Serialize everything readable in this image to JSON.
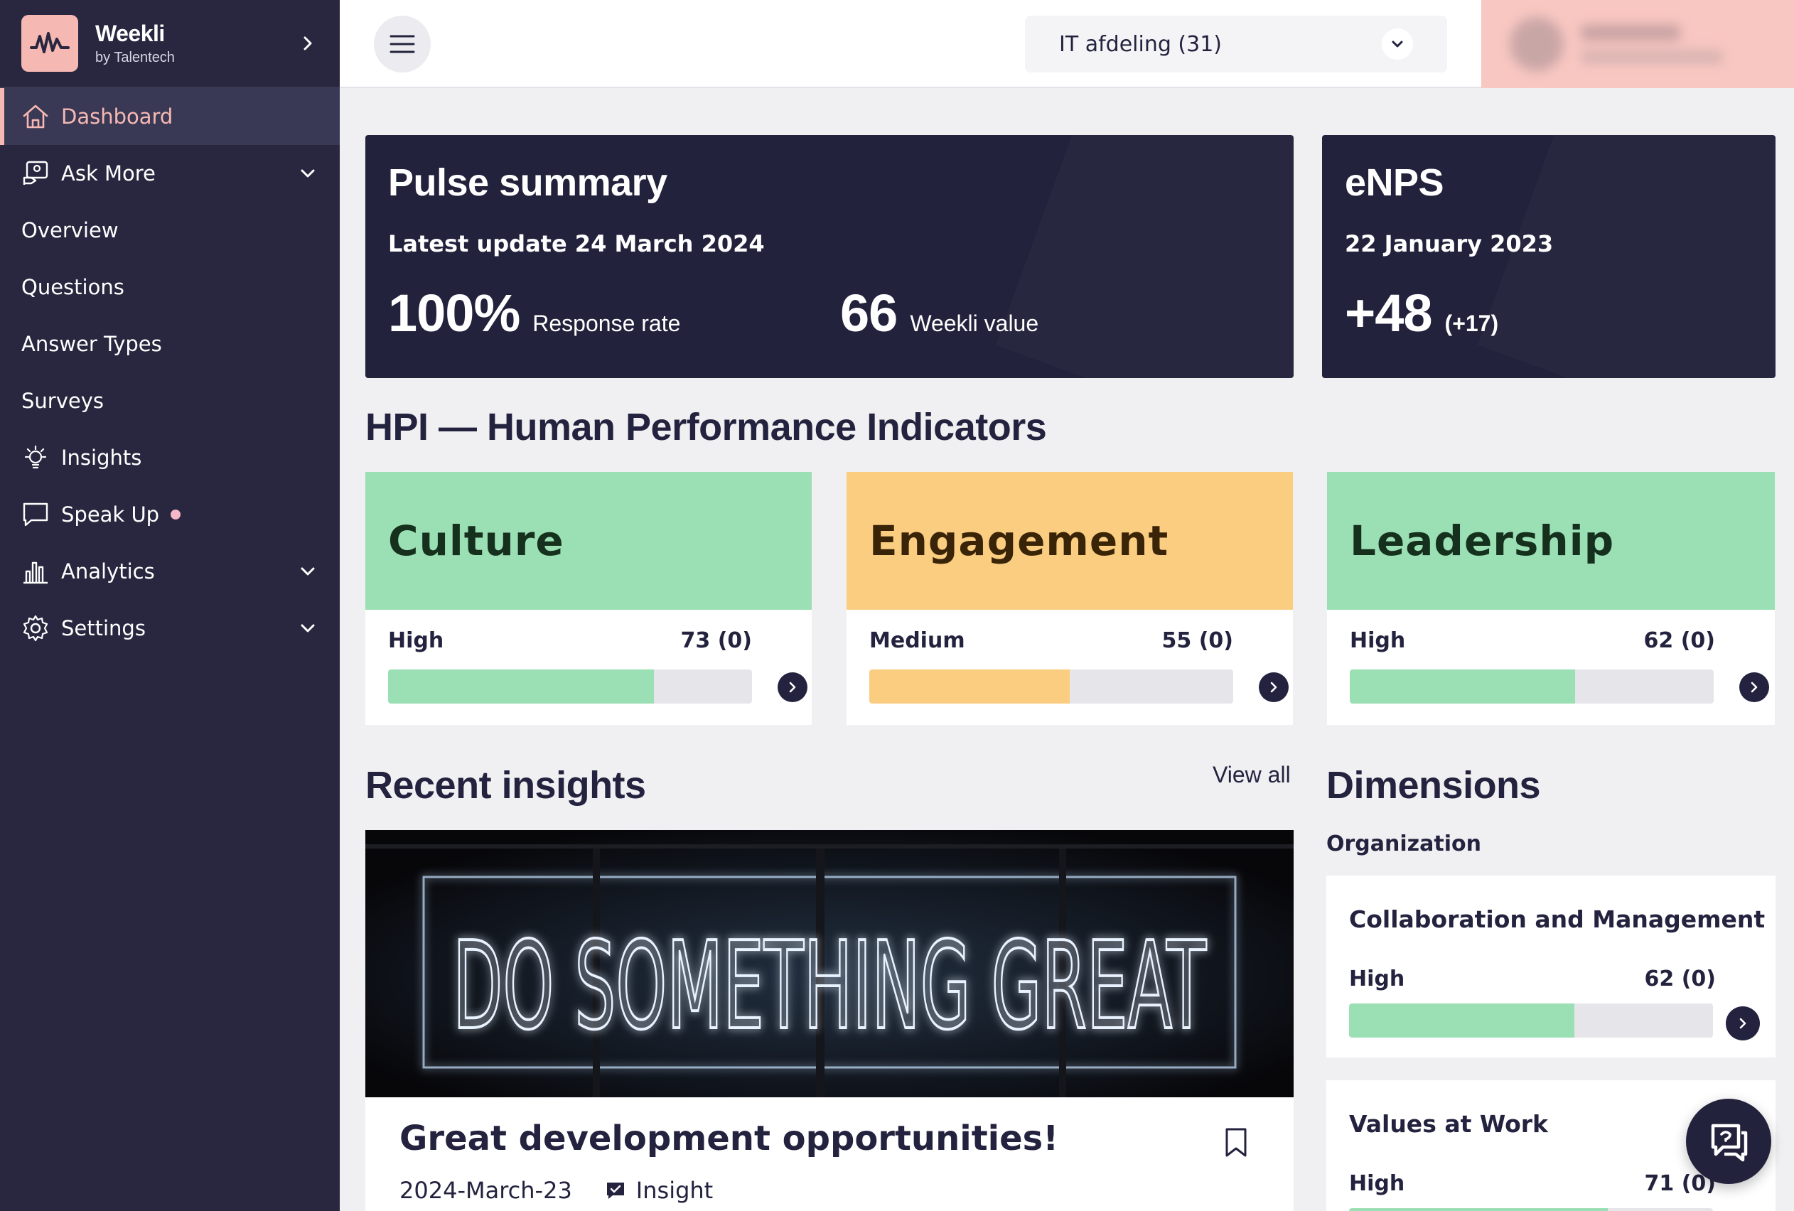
{
  "brand": {
    "name": "Weekli",
    "sub": "by Talentech"
  },
  "sidebar": {
    "items": [
      {
        "label": "Dashboard",
        "icon": "home-icon",
        "active": true
      },
      {
        "label": "Ask More",
        "icon": "ask-more-icon",
        "expandable": true
      },
      {
        "label": "Overview"
      },
      {
        "label": "Questions"
      },
      {
        "label": "Answer Types"
      },
      {
        "label": "Surveys"
      },
      {
        "label": "Insights",
        "icon": "lightbulb-icon"
      },
      {
        "label": "Speak Up",
        "icon": "speech-bubble-icon",
        "badge_dot": true
      },
      {
        "label": "Analytics",
        "icon": "bar-chart-icon",
        "expandable": true
      },
      {
        "label": "Settings",
        "icon": "gear-icon",
        "expandable": true
      }
    ]
  },
  "topbar": {
    "org_select": "IT afdeling (31)"
  },
  "pulse": {
    "title": "Pulse summary",
    "subtitle": "Latest update 24 March 2024",
    "response_value": "100%",
    "response_label": "Response rate",
    "weekli_value": "66",
    "weekli_label": "Weekli value"
  },
  "enps": {
    "title": "eNPS",
    "date": "22 January 2023",
    "value": "+48",
    "delta": "(+17)"
  },
  "hpi": {
    "heading": "HPI — Human Performance Indicators",
    "cards": [
      {
        "title": "Culture",
        "level": "High",
        "score": "73 (0)",
        "percent": 73,
        "head_color": "#9bdfb4",
        "bar_color": "#9bdfb4",
        "title_color": "#15301d"
      },
      {
        "title": "Engagement",
        "level": "Medium",
        "score": "55 (0)",
        "percent": 55,
        "head_color": "#fbcd80",
        "bar_color": "#fbcd80",
        "title_color": "#3a2408"
      },
      {
        "title": "Leadership",
        "level": "High",
        "score": "62 (0)",
        "percent": 62,
        "head_color": "#9bdfb4",
        "bar_color": "#9bdfb4",
        "title_color": "#15301d"
      }
    ]
  },
  "insights": {
    "heading": "Recent insights",
    "view_all": "View all",
    "image_text": "DO SOMETHING GREAT",
    "card": {
      "title": "Great development opportunities!",
      "date": "2024-March-23",
      "type": "Insight"
    }
  },
  "dimensions": {
    "heading": "Dimensions",
    "group": "Organization",
    "cards": [
      {
        "title": "Collaboration and Management",
        "level": "High",
        "score": "62 (0)",
        "percent": 62
      },
      {
        "title": "Values at Work",
        "level": "High",
        "score": "71 (0)",
        "percent": 71
      }
    ]
  },
  "colors": {
    "sidebar_bg": "#28273f",
    "accent_pink": "#f6b8b3",
    "dark_card": "#23223c",
    "green": "#9bdfb4",
    "orange": "#fbcd80"
  }
}
